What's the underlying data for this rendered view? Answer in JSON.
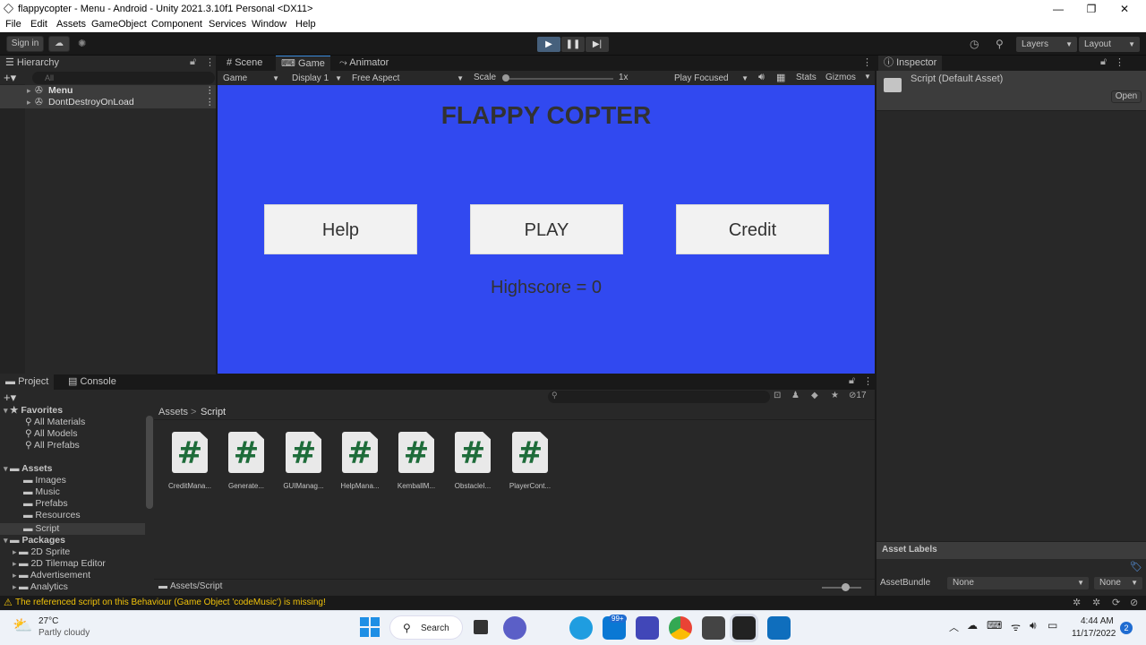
{
  "window": {
    "title": "flappycopter - Menu - Android - Unity 2021.3.10f1 Personal <DX11>",
    "minimize": "—",
    "maximize": "❐",
    "close": "✕"
  },
  "menu": [
    "File",
    "Edit",
    "Assets",
    "GameObject",
    "Component",
    "Services",
    "Window",
    "Help"
  ],
  "toolbar": {
    "sign_in": "Sign in",
    "layers": "Layers",
    "layout": "Layout"
  },
  "hierarchy": {
    "tab": "Hierarchy",
    "search_placeholder": "All",
    "items": [
      "Menu",
      "DontDestroyOnLoad"
    ]
  },
  "center_tabs": [
    "Scene",
    "Game",
    "Animator"
  ],
  "game_toolbar": {
    "view": "Game",
    "display": "Display 1",
    "aspect": "Free Aspect",
    "scale_label": "Scale",
    "scale_value": "1x",
    "play_mode": "Play Focused",
    "stats": "Stats",
    "gizmos": "Gizmos"
  },
  "game": {
    "title": "FLAPPY COPTER",
    "buttons": [
      "Help",
      "PLAY",
      "Credit"
    ],
    "highscore": "Highscore = 0",
    "bg_color": "#3149f0"
  },
  "inspector": {
    "tab": "Inspector",
    "asset": "Script (Default Asset)",
    "open": "Open",
    "labels_title": "Asset Labels",
    "bundle_label": "AssetBundle",
    "bundle_value": "None",
    "variant_value": "None"
  },
  "project": {
    "tabs": [
      "Project",
      "Console"
    ],
    "hidden_count": "17",
    "favorites": {
      "label": "Favorites",
      "items": [
        "All Materials",
        "All Models",
        "All Prefabs"
      ]
    },
    "assets": {
      "label": "Assets",
      "items": [
        "Images",
        "Music",
        "Prefabs",
        "Resources",
        "Script"
      ]
    },
    "packages": {
      "label": "Packages",
      "items": [
        "2D Sprite",
        "2D Tilemap Editor",
        "Advertisement",
        "Analytics"
      ]
    },
    "breadcrumb": [
      "Assets",
      "Script"
    ],
    "files": [
      "CreditMana...",
      "Generate...",
      "GUIManag...",
      "HelpMana...",
      "KemballM...",
      "ObstacleI...",
      "PlayerCont..."
    ],
    "path": "Assets/Script"
  },
  "status": {
    "warning": "The referenced script on this Behaviour (Game Object 'codeMusic') is missing!"
  },
  "taskbar": {
    "temp": "27°C",
    "weather": "Partly cloudy",
    "search": "Search",
    "mail_badge": "99+",
    "time": "4:44 AM",
    "date": "11/17/2022",
    "notif": "2"
  },
  "colors": {
    "accent": "#3d8fe0",
    "game_bg": "#3149f0",
    "warning": "#f0c20a"
  }
}
